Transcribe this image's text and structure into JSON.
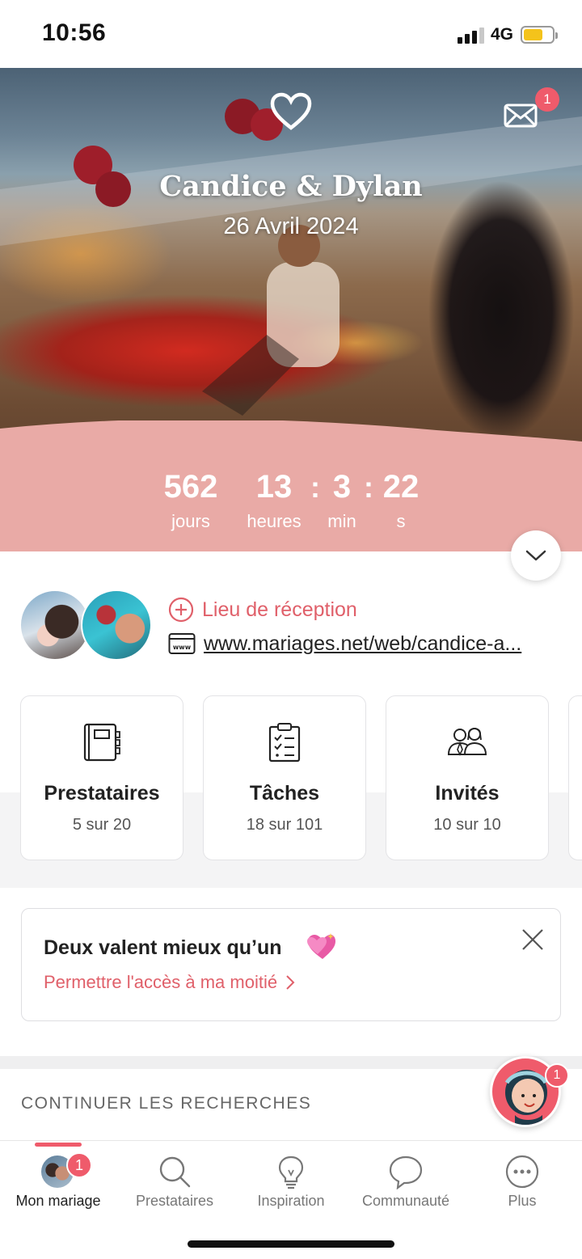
{
  "status_bar": {
    "time": "10:56",
    "network": "4G"
  },
  "hero": {
    "couple_names": "Candice & Dylan",
    "wedding_date": "26 Avril 2024",
    "messages_badge": "1",
    "countdown": {
      "days": "562",
      "days_label": "jours",
      "hours": "13",
      "hours_label": "heures",
      "minutes": "3",
      "minutes_label": "min",
      "seconds": "22",
      "seconds_label": "s",
      "separator": ":"
    }
  },
  "profile": {
    "reception_label": "Lieu de réception",
    "website_url": "www.mariages.net/web/candice-a..."
  },
  "cards": [
    {
      "title": "Prestataires",
      "progress": "5 sur 20",
      "icon": "address-book-icon"
    },
    {
      "title": "Tâches",
      "progress": "18 sur 101",
      "icon": "checklist-icon"
    },
    {
      "title": "Invités",
      "progress": "10 sur 10",
      "icon": "guests-icon"
    }
  ],
  "promo": {
    "title": "Deux valent mieux qu’un",
    "link_label": "Permettre l'accès à ma moitié"
  },
  "section": {
    "title": "CONTINUER LES RECHERCHES"
  },
  "assistant": {
    "badge": "1"
  },
  "tabbar": {
    "items": [
      {
        "label": "Mon mariage",
        "badge": "1",
        "active": true
      },
      {
        "label": "Prestataires"
      },
      {
        "label": "Inspiration"
      },
      {
        "label": "Communauté"
      },
      {
        "label": "Plus"
      }
    ]
  },
  "colors": {
    "accent": "#ef5b6b",
    "countdown_band": "#e9aaa6",
    "link": "#e0606a"
  }
}
